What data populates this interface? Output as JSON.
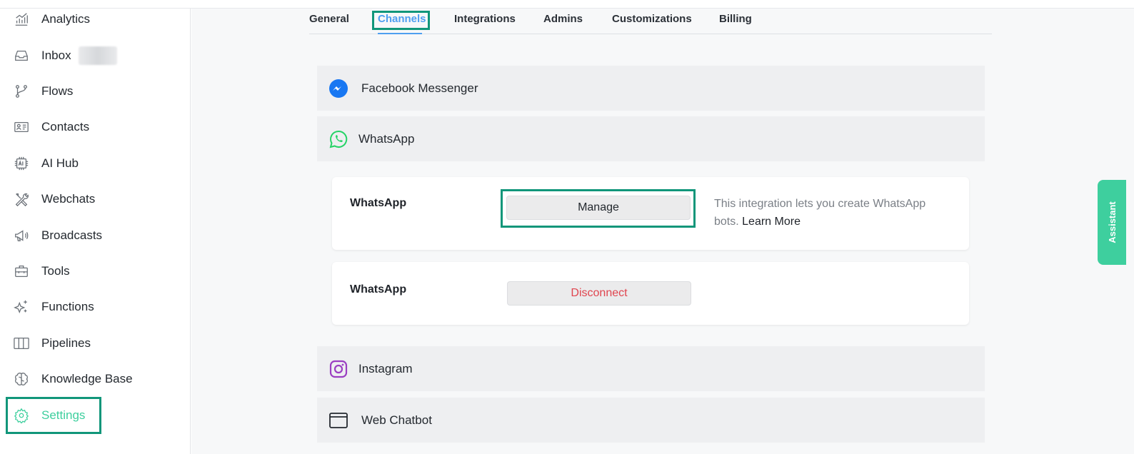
{
  "sidebar": {
    "items": [
      {
        "label": "Analytics",
        "icon": "analytics-icon"
      },
      {
        "label": "Inbox",
        "icon": "inbox-icon"
      },
      {
        "label": "Flows",
        "icon": "flows-icon"
      },
      {
        "label": "Contacts",
        "icon": "contacts-icon"
      },
      {
        "label": "AI Hub",
        "icon": "ai-chip-icon"
      },
      {
        "label": "Webchats",
        "icon": "tools-icon"
      },
      {
        "label": "Broadcasts",
        "icon": "megaphone-icon"
      },
      {
        "label": "Tools",
        "icon": "toolbox-icon"
      },
      {
        "label": "Functions",
        "icon": "sparkles-icon"
      },
      {
        "label": "Pipelines",
        "icon": "columns-icon"
      },
      {
        "label": "Knowledge Base",
        "icon": "brain-icon"
      },
      {
        "label": "Settings",
        "icon": "gear-icon"
      }
    ],
    "active": "Settings"
  },
  "tabs": {
    "items": [
      "General",
      "Channels",
      "Integrations",
      "Admins",
      "Customizations",
      "Billing"
    ],
    "active": "Channels"
  },
  "channels": {
    "facebook": {
      "label": "Facebook Messenger",
      "icon": "messenger-icon"
    },
    "whatsapp": {
      "label": "WhatsApp",
      "icon": "whatsapp-icon"
    },
    "instagram": {
      "label": "Instagram",
      "icon": "instagram-icon"
    },
    "webchatbot": {
      "label": "Web Chatbot",
      "icon": "browser-window-icon"
    }
  },
  "whatsapp_cards": {
    "card1": {
      "title": "WhatsApp",
      "button": "Manage",
      "description": "This integration lets you create WhatsApp bots.",
      "learn_more": "Learn More"
    },
    "card2": {
      "title": "WhatsApp",
      "button": "Disconnect"
    }
  },
  "assistant": {
    "label": "Assistant"
  },
  "colors": {
    "accent": "#3ecf9e",
    "highlight": "#11967a",
    "tab_active": "#4e9ff0",
    "danger": "#e0454f"
  }
}
